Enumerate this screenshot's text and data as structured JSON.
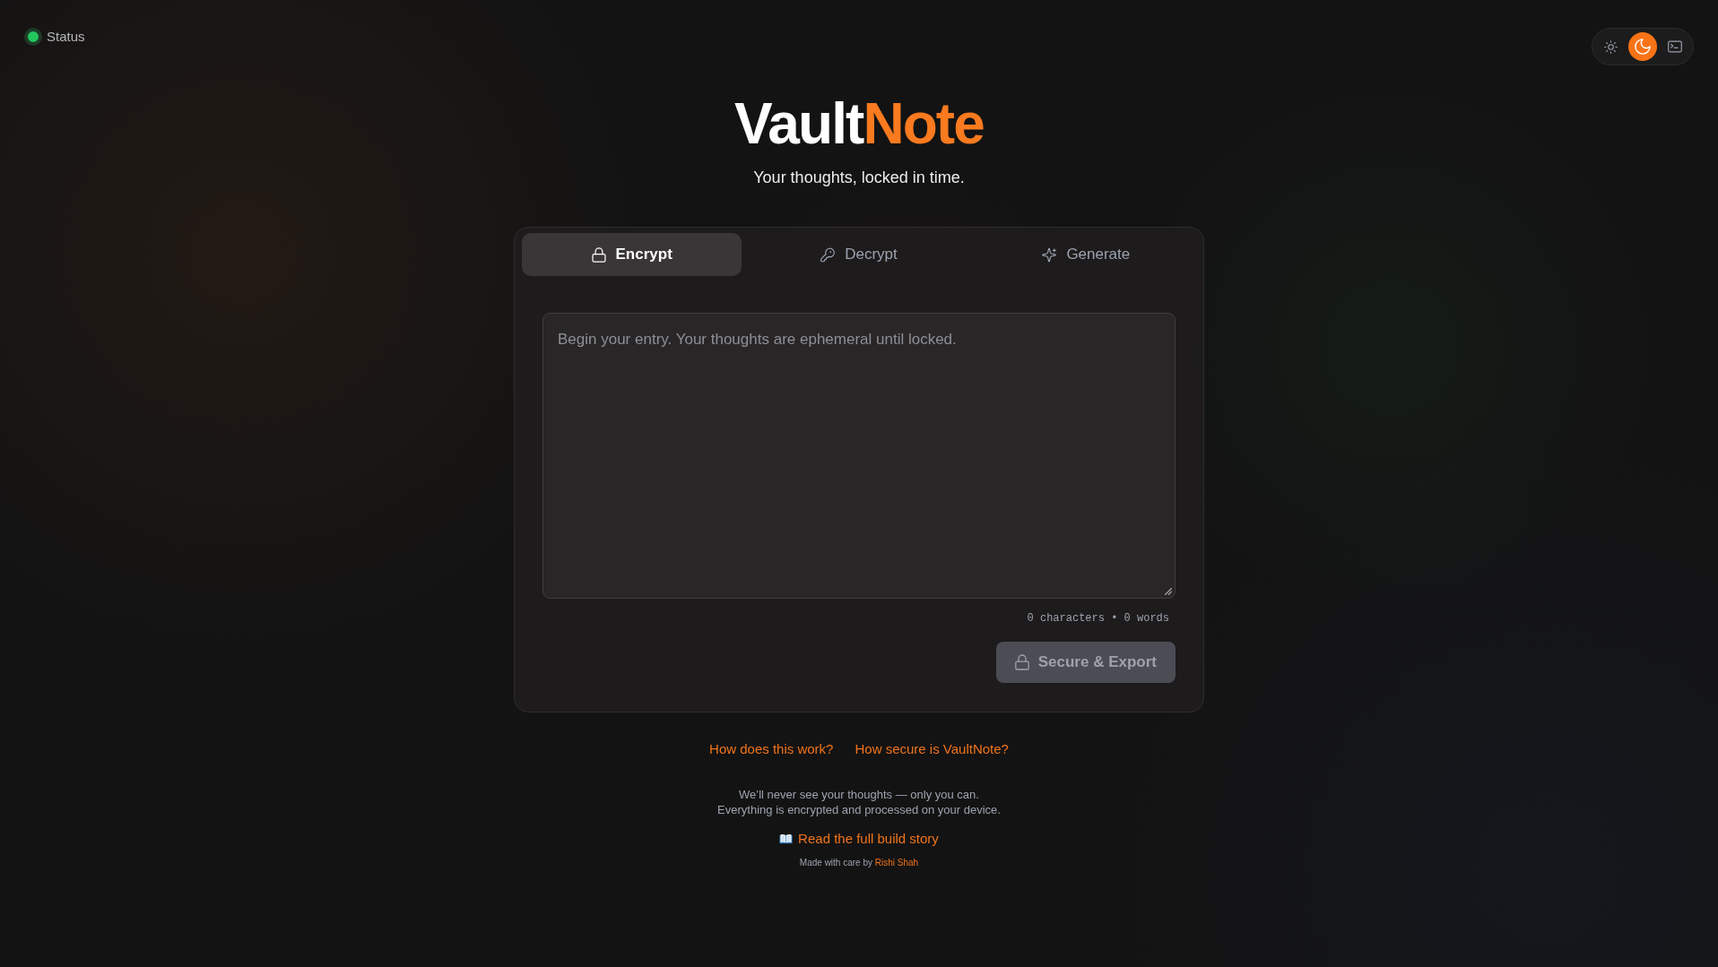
{
  "status": {
    "label": "Status",
    "color": "#22c55e"
  },
  "theme_toggle": {
    "options": [
      {
        "kind": "sun",
        "selected": false
      },
      {
        "kind": "moon",
        "selected": true
      },
      {
        "kind": "terminal",
        "selected": false
      }
    ]
  },
  "header": {
    "title_main": "Vault",
    "title_accent": "Note",
    "subtitle": "Your thoughts, locked in time."
  },
  "tabs": [
    {
      "kind": "lock",
      "label": "Encrypt",
      "selected": true
    },
    {
      "kind": "key",
      "label": "Decrypt",
      "selected": false
    },
    {
      "kind": "sparkles",
      "label": "Generate",
      "selected": false
    }
  ],
  "editor": {
    "placeholder": "Begin your entry. Your thoughts are ephemeral until locked.",
    "counter": "0 characters • 0 words"
  },
  "submit_button": {
    "label": "Secure & Export",
    "disabled": true
  },
  "help_links": [
    {
      "label": "How does this work?"
    },
    {
      "label": "How secure is VaultNote?"
    }
  ],
  "footer": {
    "notice": [
      "We’ll never see your thoughts — only you can.",
      "Everything is encrypted and processed on your device."
    ],
    "story_link": "Read the full build story",
    "credit": "Made with care by",
    "author": "Rishi Shah"
  }
}
